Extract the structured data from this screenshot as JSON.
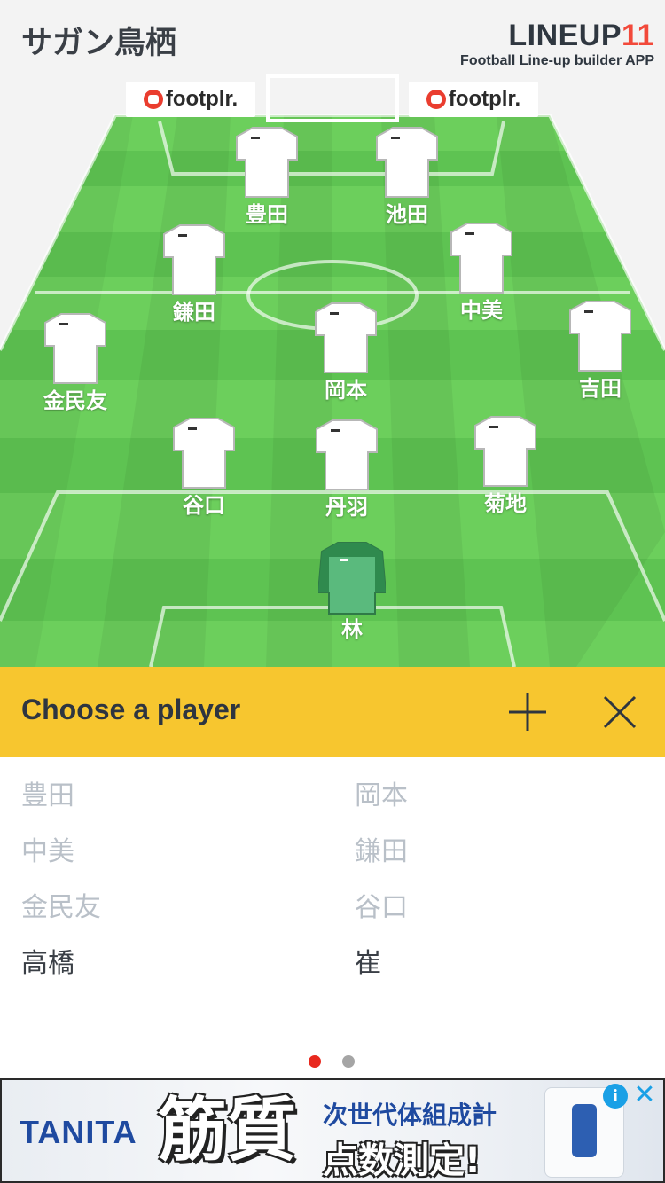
{
  "header": {
    "team_name": "サガン鳥栖",
    "brand_logo": "LINEUP",
    "brand_logo_number": "11",
    "brand_tagline": "Football Line-up builder APP"
  },
  "sponsors": [
    {
      "name": "footplr."
    },
    {
      "name": "footplr."
    }
  ],
  "players": [
    {
      "name": "豊田",
      "kit": "outfield"
    },
    {
      "name": "池田",
      "kit": "outfield"
    },
    {
      "name": "鎌田",
      "kit": "outfield"
    },
    {
      "name": "中美",
      "kit": "outfield"
    },
    {
      "name": "金民友",
      "kit": "outfield"
    },
    {
      "name": "岡本",
      "kit": "outfield"
    },
    {
      "name": "吉田",
      "kit": "outfield"
    },
    {
      "name": "谷口",
      "kit": "outfield"
    },
    {
      "name": "丹羽",
      "kit": "outfield"
    },
    {
      "name": "菊地",
      "kit": "outfield"
    },
    {
      "name": "林",
      "kit": "goalkeeper"
    }
  ],
  "chooser": {
    "title": "Choose a player",
    "add_icon": "plus-icon",
    "close_icon": "close-icon",
    "items": [
      {
        "name": "豊田",
        "status": "unavailable"
      },
      {
        "name": "岡本",
        "status": "unavailable"
      },
      {
        "name": "中美",
        "status": "unavailable"
      },
      {
        "name": "鎌田",
        "status": "unavailable"
      },
      {
        "name": "金民友",
        "status": "unavailable"
      },
      {
        "name": "谷口",
        "status": "unavailable"
      },
      {
        "name": "高橋",
        "status": "available"
      },
      {
        "name": "崔",
        "status": "available"
      }
    ],
    "pages": 2,
    "current_page": 1
  },
  "colors": {
    "header_bg": "#f3f3f3",
    "chooser_bar": "#f7c62f",
    "pitch_light": "#6ccf5c",
    "pitch_dark": "#4fb84a",
    "kit_outfield": "#ffffff",
    "kit_goalkeeper": "#43a865",
    "dot_active": "#e8281e",
    "dot_inactive": "#a5a5a5",
    "unavailable_text": "#b9c0c8"
  },
  "ad": {
    "brand": "TANITA",
    "headline": "筋質",
    "subline1": "次世代体組成計",
    "subline2": "点数測定!",
    "info_icon": "info-icon",
    "close_icon": "close-icon"
  }
}
